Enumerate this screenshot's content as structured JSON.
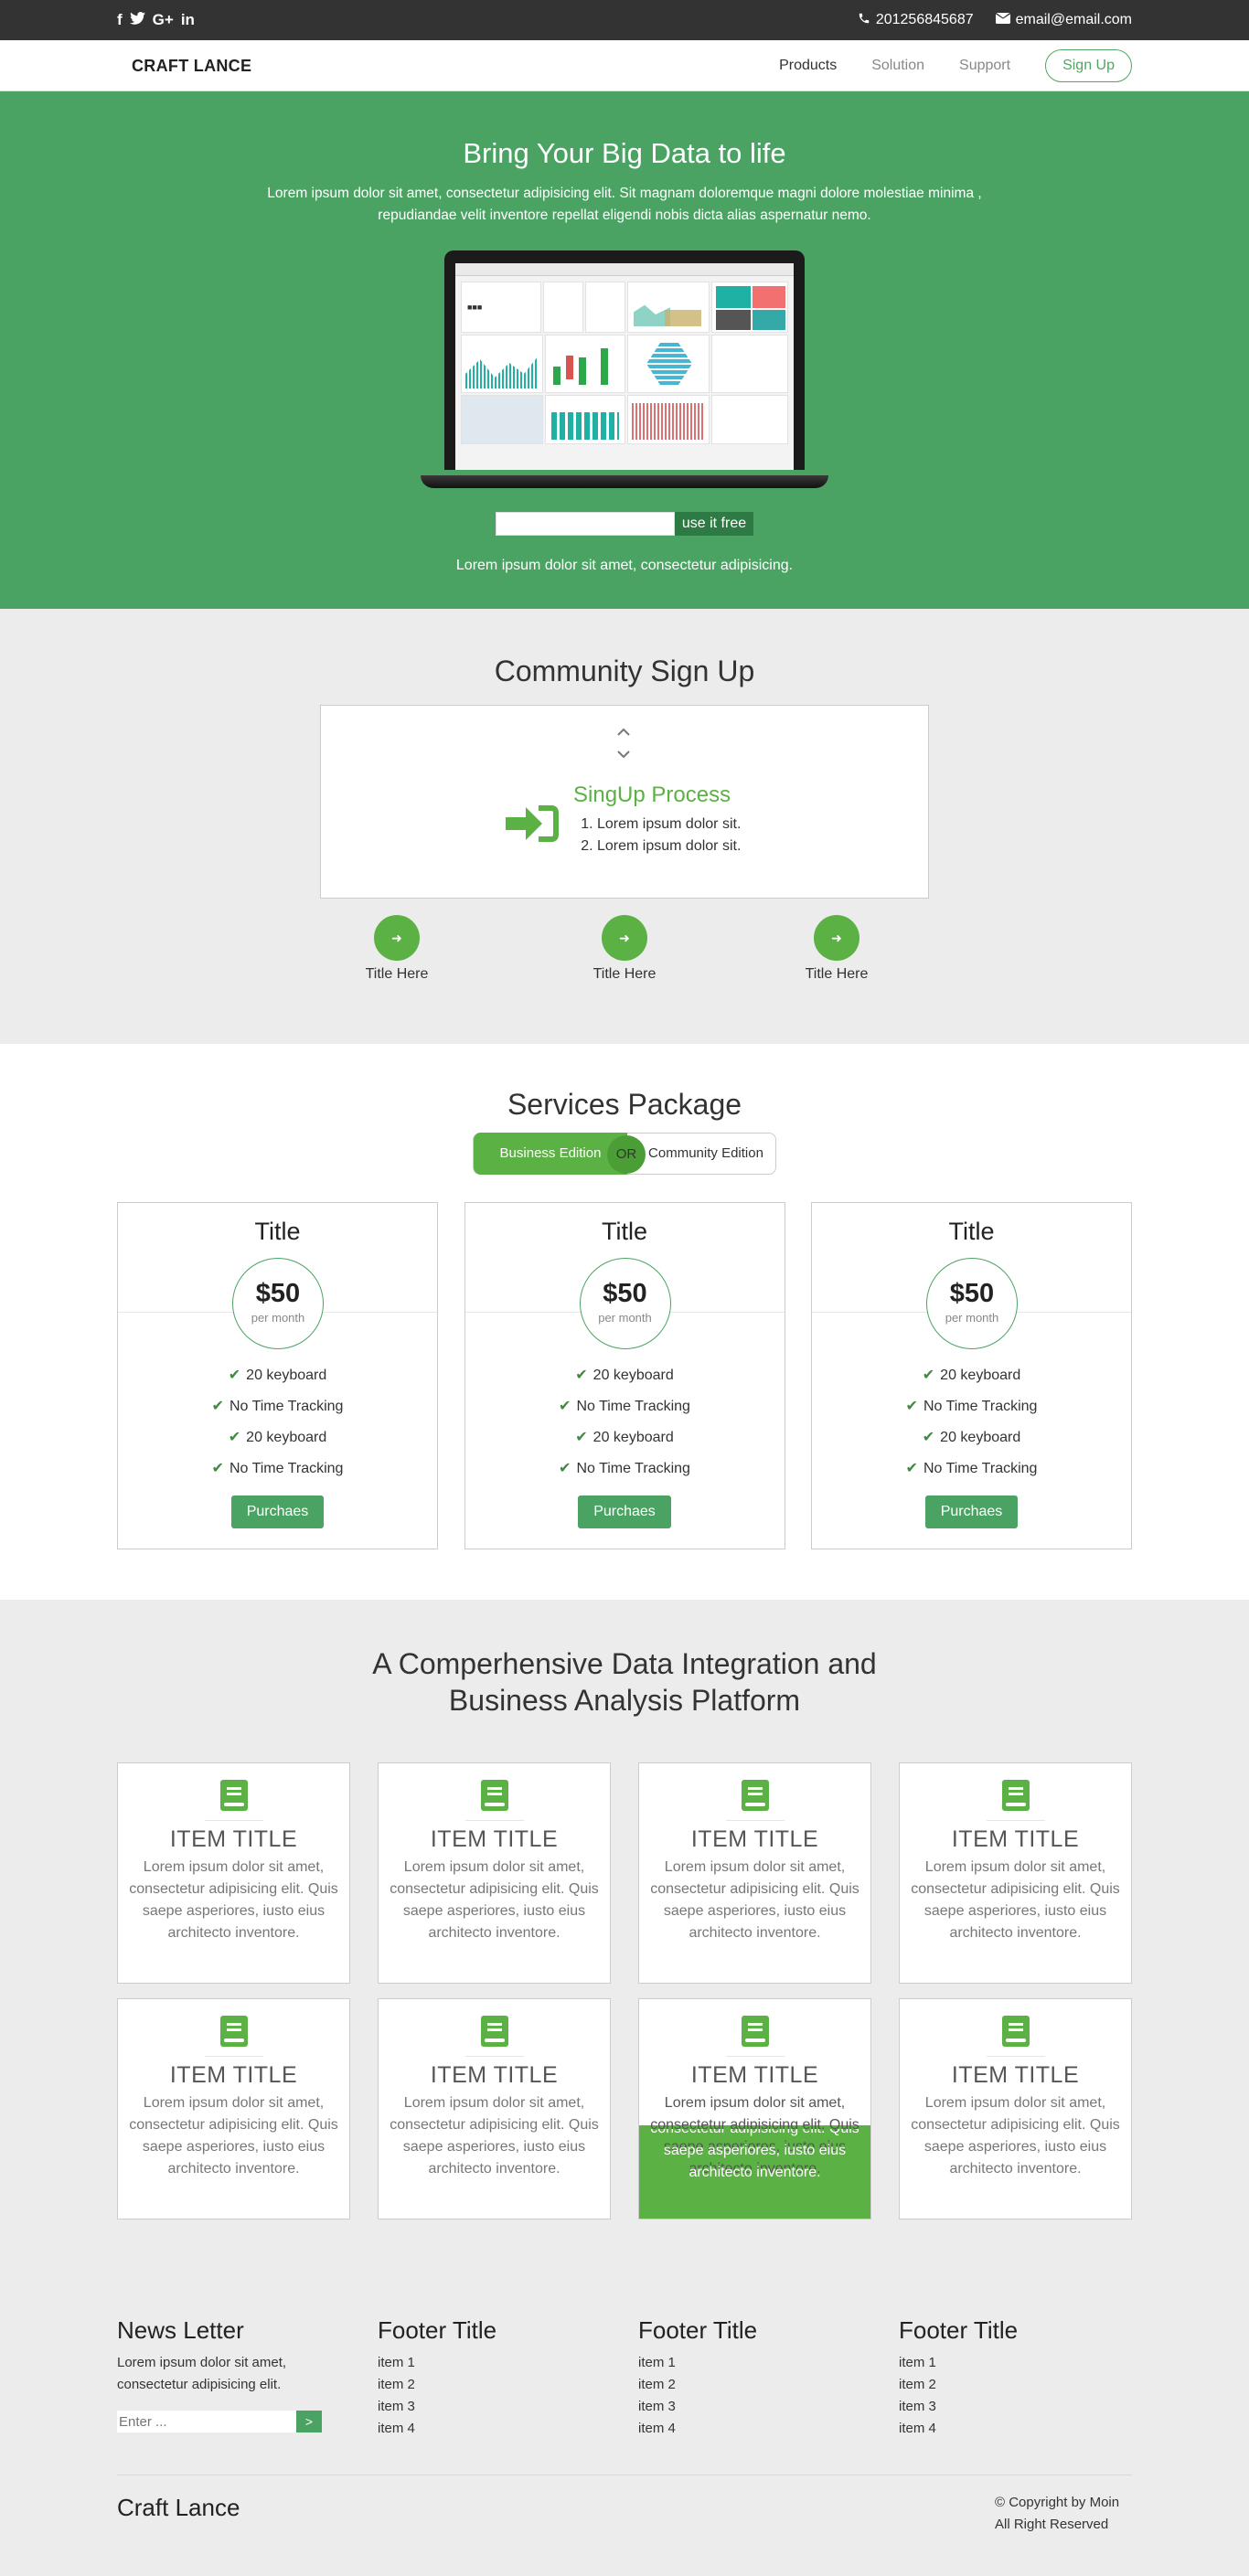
{
  "topbar": {
    "social": [
      "f",
      "t",
      "G+",
      "in"
    ],
    "phone": "201256845687",
    "email": "email@email.com"
  },
  "nav": {
    "brand": "CRAFT LANCE",
    "items": [
      "Products",
      "Solution",
      "Support"
    ],
    "signup": "Sign Up"
  },
  "hero": {
    "title": "Bring Your Big Data to life",
    "lead": "Lorem ipsum dolor sit amet, consectetur adipisicing elit. Sit magnam doloremque magni dolore molestiae minima , repudiandae velit inventore repellat eligendi nobis dicta alias aspernatur nemo.",
    "button": "use it free",
    "sub": "Lorem ipsum dolor sit amet, consectetur adipisicing."
  },
  "community": {
    "title": "Community Sign Up",
    "process_title": "SingUp Process",
    "process_items": [
      "Lorem ipsum dolor sit.",
      "Lorem ipsum dolor sit."
    ],
    "steps": [
      "Title Here",
      "Title Here",
      "Title Here"
    ]
  },
  "services": {
    "title": "Services Package",
    "toggle": {
      "option1": "Business Edition",
      "or": "OR",
      "option2": "Community Edition"
    },
    "cards": [
      {
        "title": "Title",
        "price": "$50",
        "period": "per month",
        "features": [
          "20 keyboard",
          "No Time Tracking",
          "20 keyboard",
          "No Time Tracking"
        ],
        "button": "Purchaes"
      },
      {
        "title": "Title",
        "price": "$50",
        "period": "per month",
        "features": [
          "20 keyboard",
          "No Time Tracking",
          "20 keyboard",
          "No Time Tracking"
        ],
        "button": "Purchaes"
      },
      {
        "title": "Title",
        "price": "$50",
        "period": "per month",
        "features": [
          "20 keyboard",
          "No Time Tracking",
          "20 keyboard",
          "No Time Tracking"
        ],
        "button": "Purchaes"
      }
    ]
  },
  "platform": {
    "title_line1": "A Comperhensive Data Integration and",
    "title_line2": "Business Analysis Platform",
    "item_title": "ITEM TITLE",
    "item_text": "Lorem ipsum dolor sit amet, consectetur adipisicing elit. Quis saepe asperiores, iusto eius architecto inventore.",
    "items": [
      {
        "title": "ITEM TITLE",
        "text": "Lorem ipsum dolor sit amet, consectetur adipisicing elit. Quis saepe asperiores, iusto eius architecto inventore."
      },
      {
        "title": "ITEM TITLE",
        "text": "Lorem ipsum dolor sit amet, consectetur adipisicing elit. Quis saepe asperiores, iusto eius architecto inventore."
      },
      {
        "title": "ITEM TITLE",
        "text": "Lorem ipsum dolor sit amet, consectetur adipisicing elit. Quis saepe asperiores, iusto eius architecto inventore."
      },
      {
        "title": "ITEM TITLE",
        "text": "Lorem ipsum dolor sit amet, consectetur adipisicing elit. Quis saepe asperiores, iusto eius architecto inventore."
      },
      {
        "title": "ITEM TITLE",
        "text": "Lorem ipsum dolor sit amet, consectetur adipisicing elit. Quis saepe asperiores, iusto eius architecto inventore."
      },
      {
        "title": "ITEM TITLE",
        "text": "Lorem ipsum dolor sit amet, consectetur adipisicing elit. Quis saepe asperiores, iusto eius architecto inventore."
      },
      {
        "title": "ITEM TITLE",
        "text": "Lorem ipsum dolor sit amet, consectetur adipisicing elit. Quis saepe asperiores, iusto eius architecto inventore.",
        "highlighted": true
      },
      {
        "title": "ITEM TITLE",
        "text": "Lorem ipsum dolor sit amet, consectetur adipisicing elit. Quis saepe asperiores, iusto eius architecto inventore."
      }
    ]
  },
  "footer": {
    "newsletter_title": "News Letter",
    "newsletter_text": "Lorem ipsum dolor sit amet, consectetur adipisicing elit.",
    "newsletter_placeholder": "Enter ...",
    "newsletter_button": ">",
    "columns": [
      {
        "title": "Footer Title",
        "items": [
          "item 1",
          "item 2",
          "item 3",
          "item 4"
        ]
      },
      {
        "title": "Footer Title",
        "items": [
          "item 1",
          "item 2",
          "item 3",
          "item 4"
        ]
      },
      {
        "title": "Footer Title",
        "items": [
          "item 1",
          "item 2",
          "item 3",
          "item 4"
        ]
      }
    ],
    "logo": "Craft Lance",
    "copyright_line1": "© Copyright by Moin",
    "copyright_line2": "All Right Reserved"
  },
  "colors": {
    "brand_green": "#4ba363",
    "accent_green": "#5bb143",
    "topbar": "#333333",
    "section_gray": "#ececec"
  }
}
